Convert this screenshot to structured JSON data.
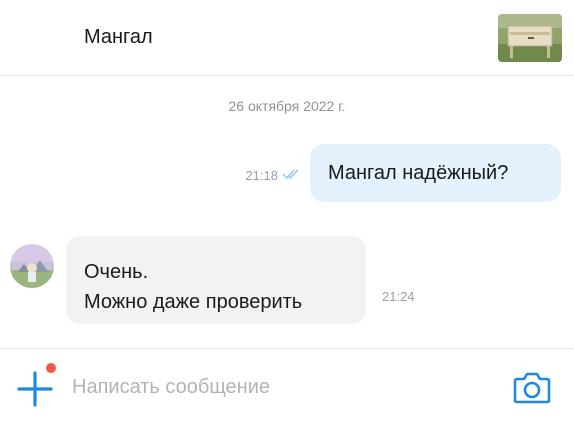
{
  "header": {
    "title": "Мангал",
    "thumbnail_icon": "listing-photo-icon"
  },
  "chat": {
    "date_separator": "26 октября 2022 г.",
    "messages": [
      {
        "direction": "outgoing",
        "lines": [
          "Мангал надёжный?"
        ],
        "time": "21:18",
        "status": "read",
        "status_icon": "double-check-icon"
      },
      {
        "direction": "incoming",
        "lines": [
          "Очень.",
          "Можно даже проверить"
        ],
        "time": "21:24"
      }
    ]
  },
  "composer": {
    "placeholder": "Написать сообщение",
    "value": "",
    "attach_icon": "plus-icon",
    "camera_icon": "camera-icon",
    "has_notification_dot": true
  },
  "colors": {
    "accent": "#1e88e5",
    "outgoing_bubble": "#e4f2fd",
    "incoming_bubble": "#f2f2f3",
    "notification_dot": "#ef5a4a",
    "muted_text": "#9aa0a6"
  }
}
